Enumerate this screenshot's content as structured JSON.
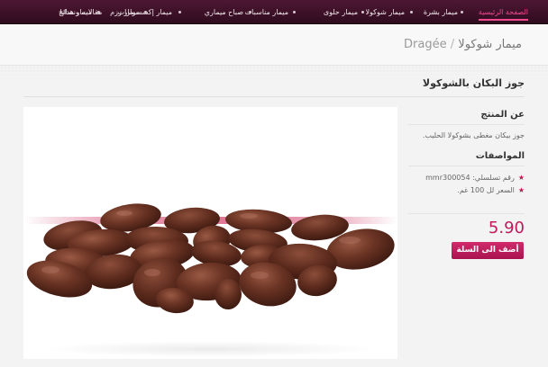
{
  "nav": {
    "items": [
      {
        "label": "الصفحة الرئيسية",
        "active": true
      },
      {
        "label": "ميمار بشرة",
        "active": false
      },
      {
        "label": "ميمار شوكولا",
        "active": false
      },
      {
        "label": "ميمار حلوى",
        "active": false
      },
      {
        "label": "ميمار مناسبات",
        "active": false
      },
      {
        "label": "صباح ميماري",
        "active": false
      },
      {
        "label": "ميمار إكسسوارات",
        "active": false
      },
      {
        "label": "ميمار رزم",
        "active": false
      },
      {
        "label": "ميمار هدايا",
        "active": false
      },
      {
        "label": "مقالات ونصائح",
        "active": false
      }
    ]
  },
  "page": {
    "title_ar": "ميمار شوكولا",
    "separator": "/",
    "title_en": "Dragée"
  },
  "product": {
    "name": "جوز البكان بالشوكولا",
    "about_title": "عن المنتج",
    "about_text": "جوز بيكان مغطى بشوكولا الحليب.",
    "specs_title": "المواصفات",
    "specs": [
      {
        "label": "رقم تسلسلي:",
        "value": "mmr300054"
      },
      {
        "label": "السعر لل 100 غم.",
        "value": ""
      }
    ],
    "price": "5.90",
    "add_to_cart_label": "أضف الى السلة"
  },
  "colors": {
    "accent": "#c2185b",
    "nav_bg": "#3d1128",
    "chocolate": "#5a2a1c"
  }
}
